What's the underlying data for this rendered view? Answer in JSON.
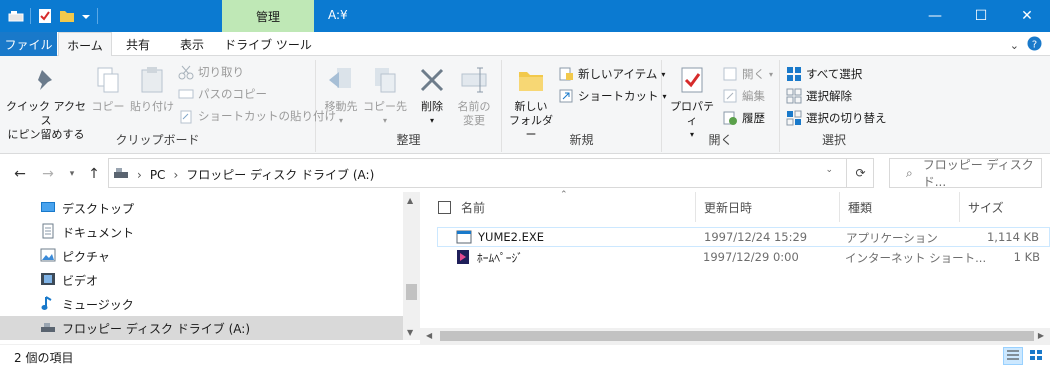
{
  "window": {
    "title": "A:¥",
    "context_tab_label": "管理",
    "minimize": "—",
    "maximize": "☐",
    "close": "✕"
  },
  "tabs": [
    {
      "label": "ファイル"
    },
    {
      "label": "ホーム"
    },
    {
      "label": "共有"
    },
    {
      "label": "表示"
    },
    {
      "label": "ドライブ ツール"
    }
  ],
  "ribbon": {
    "clipboard": {
      "label": "クリップボード",
      "pin_line1": "クイック アクセス",
      "pin_line2": "にピン留めする",
      "copy": "コピー",
      "paste": "貼り付け",
      "cut": "切り取り",
      "copy_path": "パスのコピー",
      "paste_shortcut": "ショートカットの貼り付け"
    },
    "organize": {
      "label": "整理",
      "move_to": "移動先",
      "copy_to": "コピー先",
      "delete": "削除",
      "rename_line1": "名前の",
      "rename_line2": "変更"
    },
    "new": {
      "label": "新規",
      "new_folder_line1": "新しい",
      "new_folder_line2": "フォルダー",
      "new_item": "新しいアイテム",
      "shortcut": "ショートカット"
    },
    "open": {
      "label": "開く",
      "properties": "プロパティ",
      "open": "開く",
      "edit": "編集",
      "history": "履歴"
    },
    "select": {
      "label": "選択",
      "select_all": "すべて選択",
      "select_none": "選択解除",
      "invert": "選択の切り替え"
    }
  },
  "address": {
    "crumb_pc": "PC",
    "crumb_drive": "フロッピー ディスク ドライブ (A:)",
    "search_placeholder": "フロッピー ディスク ド..."
  },
  "nav": [
    {
      "label": "デスクトップ",
      "icon": "desktop-icon"
    },
    {
      "label": "ドキュメント",
      "icon": "document-icon"
    },
    {
      "label": "ピクチャ",
      "icon": "pictures-icon"
    },
    {
      "label": "ビデオ",
      "icon": "video-icon"
    },
    {
      "label": "ミュージック",
      "icon": "music-icon"
    },
    {
      "label": "フロッピー ディスク ドライブ (A:)",
      "icon": "floppy-drive-icon",
      "selected": true
    }
  ],
  "columns": {
    "name": "名前",
    "date": "更新日時",
    "type": "種類",
    "size": "サイズ"
  },
  "files": [
    {
      "name": "YUME2.EXE",
      "date": "1997/12/24 15:29",
      "type": "アプリケーション",
      "size": "1,114 KB",
      "icon": "exe-icon",
      "selected": true
    },
    {
      "name": "ﾎｰﾑﾍﾟｰｼﾞ",
      "date": "1997/12/29 0:00",
      "type": "インターネット ショート...",
      "size": "1 KB",
      "icon": "internet-shortcut-icon",
      "selected": false
    }
  ],
  "status": {
    "item_count": "2 個の項目"
  },
  "colors": {
    "titlebar": "#0b7ad1",
    "context_tab": "#bfe8b6",
    "file_tab": "#1979ca",
    "selection": "#cce8ff"
  }
}
